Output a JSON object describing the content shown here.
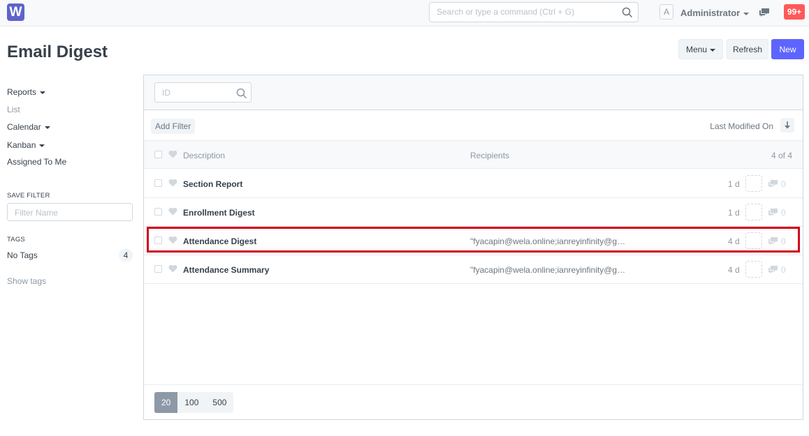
{
  "navbar": {
    "logo_letter": "W",
    "search_placeholder": "Search or type a command (Ctrl + G)",
    "avatar_letter": "A",
    "user_name": "Administrator",
    "notifications": "99+"
  },
  "page": {
    "title": "Email Digest",
    "menu_label": "Menu",
    "refresh_label": "Refresh",
    "new_label": "New"
  },
  "sidebar": {
    "reports": "Reports",
    "list": "List",
    "calendar": "Calendar",
    "kanban": "Kanban",
    "assigned": "Assigned To Me",
    "save_filter_heading": "SAVE FILTER",
    "filter_name_placeholder": "Filter Name",
    "tags_heading": "TAGS",
    "no_tags": "No Tags",
    "no_tags_count": "4",
    "show_tags": "Show tags"
  },
  "list": {
    "id_placeholder": "ID",
    "add_filter": "Add Filter",
    "sort_label": "Last Modified On",
    "columns": {
      "description": "Description",
      "recipients": "Recipients",
      "count": "4 of 4"
    },
    "rows": [
      {
        "title": "Section Report",
        "recipients": "",
        "age": "1 d",
        "comments": "0"
      },
      {
        "title": "Enrollment Digest",
        "recipients": "",
        "age": "1 d",
        "comments": "0"
      },
      {
        "title": "Attendance Digest",
        "recipients": "\"fyacapin@wela.online;ianreyinfinity@g…",
        "age": "4 d",
        "comments": "0"
      },
      {
        "title": "Attendance Summary",
        "recipients": "\"fyacapin@wela.online;ianreyinfinity@g…",
        "age": "4 d",
        "comments": "0"
      }
    ],
    "page_sizes": [
      "20",
      "100",
      "500"
    ]
  },
  "colors": {
    "primary": "#5e64ff",
    "notification": "#ff5858",
    "highlight": "#d0021b"
  }
}
